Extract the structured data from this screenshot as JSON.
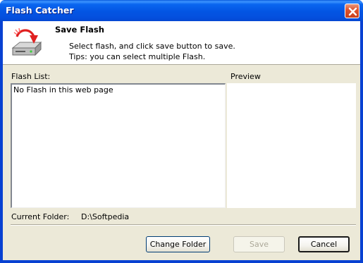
{
  "window": {
    "title": "Flash Catcher",
    "close_icon": "close-icon"
  },
  "header": {
    "title": "Save Flash",
    "line1": "Select flash, and click save button to save.",
    "line2": "Tips: you can select multiple Flash.",
    "icon": "save-drive-icon"
  },
  "flash_list": {
    "label": "Flash List:",
    "items": [
      "No Flash in this web page"
    ]
  },
  "preview": {
    "label": "Preview"
  },
  "current_folder": {
    "label": "Current Folder:",
    "value": "D:\\Softpedia"
  },
  "buttons": {
    "change_folder": "Change Folder",
    "save": "Save",
    "cancel": "Cancel"
  },
  "colors": {
    "titlebar": "#0355e3",
    "dialog_bg": "#ece9d8",
    "close_button": "#e0542e"
  }
}
